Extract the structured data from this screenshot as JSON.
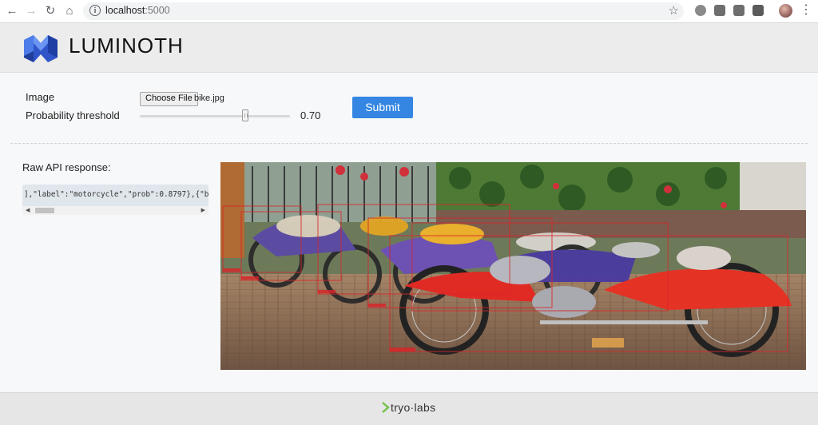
{
  "browser": {
    "url_host": "localhost",
    "url_port": ":5000"
  },
  "app": {
    "brand": "LUMINOTH"
  },
  "form": {
    "image_label": "Image",
    "choose_file_label": "Choose File",
    "file_name": "bike.jpg",
    "threshold_label": "Probability threshold",
    "threshold": 0.7,
    "threshold_display": "0.70",
    "submit_label": "Submit"
  },
  "api": {
    "title": "Raw API response:",
    "raw_visible": "],\"label\":\"motorcycle\",\"prob\":0.8797},{\"bbox"
  },
  "result": {
    "detected_label": "motorcycle",
    "box_color": "#d8262a"
  },
  "footer": {
    "brand": "tryo·labs",
    "accent": "#6fc24b"
  },
  "colors": {
    "submit": "#3586e3",
    "header_bg": "#ececec"
  }
}
